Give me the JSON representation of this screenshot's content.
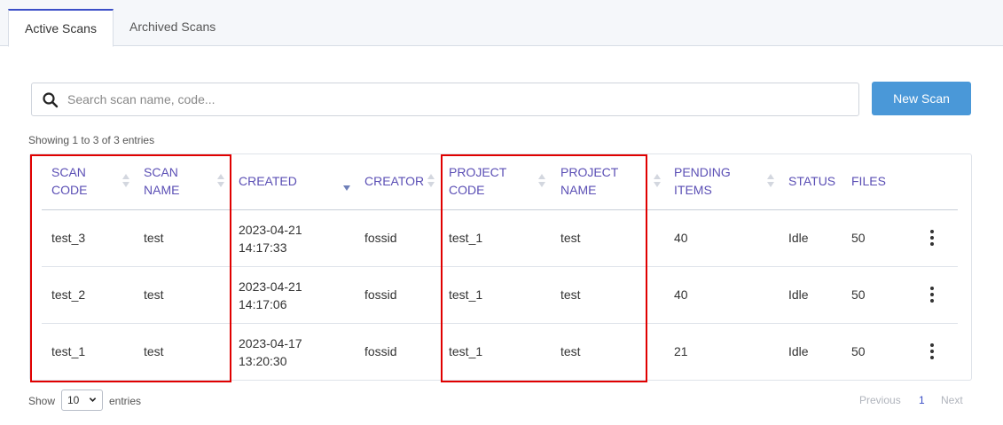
{
  "tabs": [
    {
      "label": "Active Scans",
      "active": true
    },
    {
      "label": "Archived Scans",
      "active": false
    }
  ],
  "search": {
    "placeholder": "Search scan name, code...",
    "value": "",
    "icon": "search-icon"
  },
  "new_scan_button": {
    "label": "New Scan",
    "color": "#4a98d8"
  },
  "info_text": "Showing 1 to 3 of 3 entries",
  "table": {
    "columns": [
      {
        "key": "scan_code",
        "label_l1": "SCAN",
        "label_l2": "CODE",
        "sortable": true
      },
      {
        "key": "scan_name",
        "label_l1": "SCAN",
        "label_l2": "NAME",
        "sortable": true
      },
      {
        "key": "created",
        "label_l1": "CREATED",
        "label_l2": "",
        "sortable": true,
        "sorted": "desc"
      },
      {
        "key": "creator",
        "label_l1": "CREATOR",
        "label_l2": "",
        "sortable": true
      },
      {
        "key": "project_code",
        "label_l1": "PROJECT",
        "label_l2": "CODE",
        "sortable": true
      },
      {
        "key": "project_name",
        "label_l1": "PROJECT",
        "label_l2": "NAME",
        "sortable": true
      },
      {
        "key": "pending_items",
        "label_l1": "PENDING",
        "label_l2": "ITEMS",
        "sortable": true
      },
      {
        "key": "status",
        "label_l1": "STATUS",
        "label_l2": "",
        "sortable": false
      },
      {
        "key": "files",
        "label_l1": "FILES",
        "label_l2": "",
        "sortable": false
      }
    ],
    "rows": [
      {
        "scan_code": "test_3",
        "scan_name": "test",
        "created_date": "2023-04-21",
        "created_time": "14:17:33",
        "creator": "fossid",
        "project_code": "test_1",
        "project_name": "test",
        "pending_items": "40",
        "status": "Idle",
        "files": "50"
      },
      {
        "scan_code": "test_2",
        "scan_name": "test",
        "created_date": "2023-04-21",
        "created_time": "14:17:06",
        "creator": "fossid",
        "project_code": "test_1",
        "project_name": "test",
        "pending_items": "40",
        "status": "Idle",
        "files": "50"
      },
      {
        "scan_code": "test_1",
        "scan_name": "test",
        "created_date": "2023-04-17",
        "created_time": "13:20:30",
        "creator": "fossid",
        "project_code": "test_1",
        "project_name": "test",
        "pending_items": "21",
        "status": "Idle",
        "files": "50"
      }
    ]
  },
  "footer": {
    "show_label": "Show",
    "page_length": "10",
    "entries_label": "entries",
    "prev_label": "Previous",
    "current_page": "1",
    "next_label": "Next"
  },
  "colors": {
    "accent": "#3a4ec7",
    "header_text": "#5b4fb5",
    "highlight": "#e00000"
  }
}
